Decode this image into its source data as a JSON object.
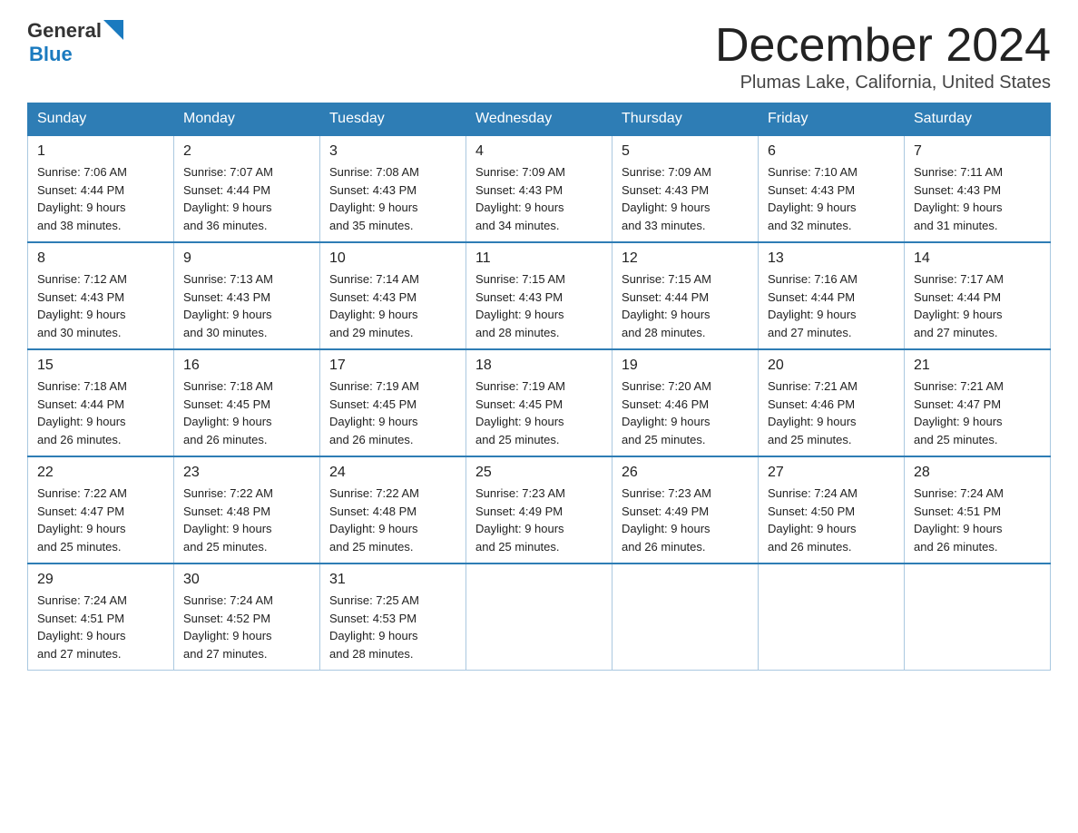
{
  "header": {
    "logo_general": "General",
    "logo_blue": "Blue",
    "title": "December 2024",
    "location": "Plumas Lake, California, United States"
  },
  "days_of_week": [
    "Sunday",
    "Monday",
    "Tuesday",
    "Wednesday",
    "Thursday",
    "Friday",
    "Saturday"
  ],
  "weeks": [
    [
      {
        "day": "1",
        "sunrise": "7:06 AM",
        "sunset": "4:44 PM",
        "daylight": "9 hours and 38 minutes."
      },
      {
        "day": "2",
        "sunrise": "7:07 AM",
        "sunset": "4:44 PM",
        "daylight": "9 hours and 36 minutes."
      },
      {
        "day": "3",
        "sunrise": "7:08 AM",
        "sunset": "4:43 PM",
        "daylight": "9 hours and 35 minutes."
      },
      {
        "day": "4",
        "sunrise": "7:09 AM",
        "sunset": "4:43 PM",
        "daylight": "9 hours and 34 minutes."
      },
      {
        "day": "5",
        "sunrise": "7:09 AM",
        "sunset": "4:43 PM",
        "daylight": "9 hours and 33 minutes."
      },
      {
        "day": "6",
        "sunrise": "7:10 AM",
        "sunset": "4:43 PM",
        "daylight": "9 hours and 32 minutes."
      },
      {
        "day": "7",
        "sunrise": "7:11 AM",
        "sunset": "4:43 PM",
        "daylight": "9 hours and 31 minutes."
      }
    ],
    [
      {
        "day": "8",
        "sunrise": "7:12 AM",
        "sunset": "4:43 PM",
        "daylight": "9 hours and 30 minutes."
      },
      {
        "day": "9",
        "sunrise": "7:13 AM",
        "sunset": "4:43 PM",
        "daylight": "9 hours and 30 minutes."
      },
      {
        "day": "10",
        "sunrise": "7:14 AM",
        "sunset": "4:43 PM",
        "daylight": "9 hours and 29 minutes."
      },
      {
        "day": "11",
        "sunrise": "7:15 AM",
        "sunset": "4:43 PM",
        "daylight": "9 hours and 28 minutes."
      },
      {
        "day": "12",
        "sunrise": "7:15 AM",
        "sunset": "4:44 PM",
        "daylight": "9 hours and 28 minutes."
      },
      {
        "day": "13",
        "sunrise": "7:16 AM",
        "sunset": "4:44 PM",
        "daylight": "9 hours and 27 minutes."
      },
      {
        "day": "14",
        "sunrise": "7:17 AM",
        "sunset": "4:44 PM",
        "daylight": "9 hours and 27 minutes."
      }
    ],
    [
      {
        "day": "15",
        "sunrise": "7:18 AM",
        "sunset": "4:44 PM",
        "daylight": "9 hours and 26 minutes."
      },
      {
        "day": "16",
        "sunrise": "7:18 AM",
        "sunset": "4:45 PM",
        "daylight": "9 hours and 26 minutes."
      },
      {
        "day": "17",
        "sunrise": "7:19 AM",
        "sunset": "4:45 PM",
        "daylight": "9 hours and 26 minutes."
      },
      {
        "day": "18",
        "sunrise": "7:19 AM",
        "sunset": "4:45 PM",
        "daylight": "9 hours and 25 minutes."
      },
      {
        "day": "19",
        "sunrise": "7:20 AM",
        "sunset": "4:46 PM",
        "daylight": "9 hours and 25 minutes."
      },
      {
        "day": "20",
        "sunrise": "7:21 AM",
        "sunset": "4:46 PM",
        "daylight": "9 hours and 25 minutes."
      },
      {
        "day": "21",
        "sunrise": "7:21 AM",
        "sunset": "4:47 PM",
        "daylight": "9 hours and 25 minutes."
      }
    ],
    [
      {
        "day": "22",
        "sunrise": "7:22 AM",
        "sunset": "4:47 PM",
        "daylight": "9 hours and 25 minutes."
      },
      {
        "day": "23",
        "sunrise": "7:22 AM",
        "sunset": "4:48 PM",
        "daylight": "9 hours and 25 minutes."
      },
      {
        "day": "24",
        "sunrise": "7:22 AM",
        "sunset": "4:48 PM",
        "daylight": "9 hours and 25 minutes."
      },
      {
        "day": "25",
        "sunrise": "7:23 AM",
        "sunset": "4:49 PM",
        "daylight": "9 hours and 25 minutes."
      },
      {
        "day": "26",
        "sunrise": "7:23 AM",
        "sunset": "4:49 PM",
        "daylight": "9 hours and 26 minutes."
      },
      {
        "day": "27",
        "sunrise": "7:24 AM",
        "sunset": "4:50 PM",
        "daylight": "9 hours and 26 minutes."
      },
      {
        "day": "28",
        "sunrise": "7:24 AM",
        "sunset": "4:51 PM",
        "daylight": "9 hours and 26 minutes."
      }
    ],
    [
      {
        "day": "29",
        "sunrise": "7:24 AM",
        "sunset": "4:51 PM",
        "daylight": "9 hours and 27 minutes."
      },
      {
        "day": "30",
        "sunrise": "7:24 AM",
        "sunset": "4:52 PM",
        "daylight": "9 hours and 27 minutes."
      },
      {
        "day": "31",
        "sunrise": "7:25 AM",
        "sunset": "4:53 PM",
        "daylight": "9 hours and 28 minutes."
      },
      null,
      null,
      null,
      null
    ]
  ],
  "labels": {
    "sunrise": "Sunrise:",
    "sunset": "Sunset:",
    "daylight": "Daylight:"
  }
}
